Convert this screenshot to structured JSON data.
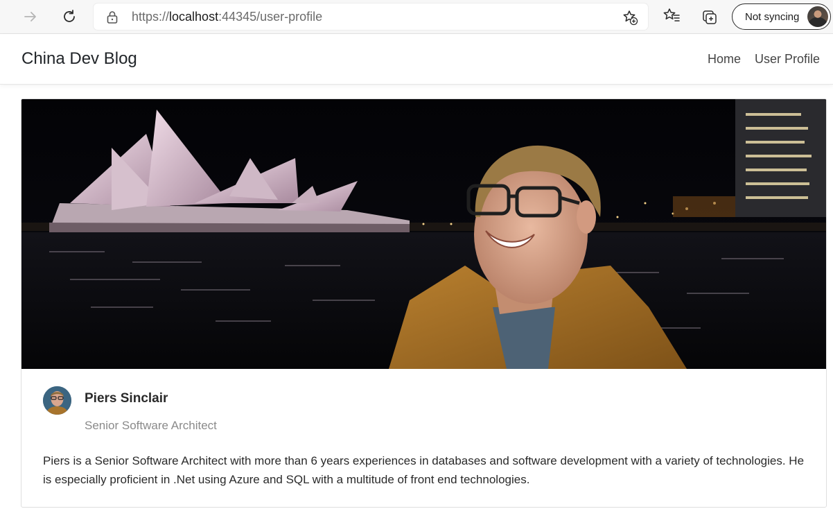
{
  "browser": {
    "url_scheme": "https://",
    "url_host": "localhost",
    "url_rest": ":44345/user-profile",
    "sync_label": "Not syncing",
    "icons": [
      "forward-icon",
      "refresh-icon",
      "lock-icon",
      "add-favorite-icon",
      "favorites-icon",
      "collections-icon"
    ]
  },
  "site": {
    "brand": "China Dev Blog",
    "nav": [
      {
        "label": "Home"
      },
      {
        "label": "User Profile"
      }
    ]
  },
  "profile": {
    "name": "Piers Sinclair",
    "title": "Senior Software Architect",
    "bio": "Piers is a Senior Software Architect with more than 6 years experiences in databases and software development with a variety of technologies. He is especially proficient in .Net using Azure and SQL with a multitude of front end technologies."
  },
  "colors": {
    "text": "#212529",
    "muted": "#8a8a8a",
    "border": "#dedede"
  }
}
